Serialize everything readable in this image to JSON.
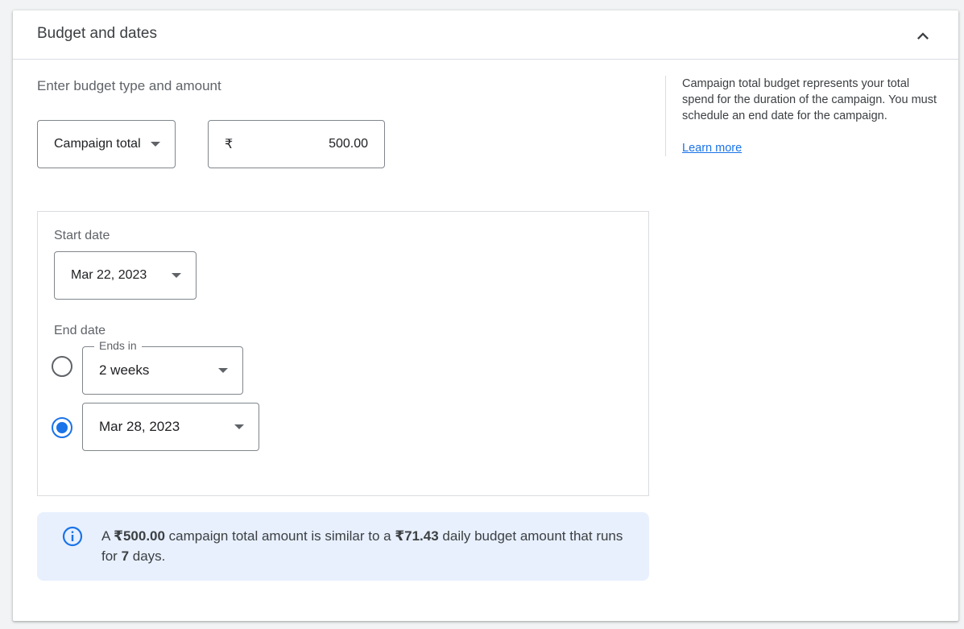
{
  "section": {
    "title": "Budget and dates",
    "collapse_icon": "chevron-up-icon"
  },
  "budget": {
    "label": "Enter budget type and amount",
    "type_value": "Campaign total",
    "currency_symbol": "₹",
    "amount": "500.00"
  },
  "help": {
    "text": "Campaign total budget represents your total spend for the duration of the campaign. You must schedule an end date for the campaign.",
    "link": "Learn more"
  },
  "dates": {
    "start_label": "Start date",
    "start_value": "Mar 22, 2023",
    "end_label": "End date",
    "ends_in_label": "Ends in",
    "ends_in_value": "2 weeks",
    "end_date_value": "Mar 28, 2023",
    "selected_option": "end_date"
  },
  "info": {
    "prefix": "A ",
    "total": "₹500.00",
    "mid": " campaign total amount is similar to a ",
    "daily": "₹71.43",
    "mid2": " daily budget amount that runs for ",
    "days": "7",
    "suffix": " days.",
    "icon": "info-icon"
  },
  "colors": {
    "accent": "#1a73e8",
    "banner_bg": "#e8f0fe"
  }
}
